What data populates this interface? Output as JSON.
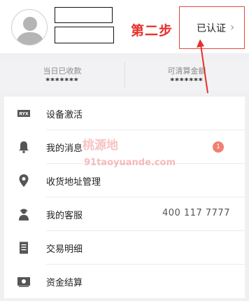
{
  "header": {
    "annotation_step": "第二步",
    "verify_label": "已认证",
    "verify_chevron": "›"
  },
  "stats": [
    {
      "caption": "当日已收款",
      "value": "*******"
    },
    {
      "caption": "可清算金额",
      "value": "*******"
    }
  ],
  "menu": [
    {
      "label": "设备激活",
      "icon": "device-activation-icon"
    },
    {
      "label": "我的消息",
      "icon": "bell-icon",
      "badge": "1"
    },
    {
      "label": "收货地址管理",
      "icon": "location-pin-icon"
    },
    {
      "label": "我的客服",
      "icon": "customer-service-icon",
      "value": "400 117 7777"
    },
    {
      "label": "交易明细",
      "icon": "document-icon"
    },
    {
      "label": "资金结算",
      "icon": "cash-icon"
    }
  ],
  "watermark": {
    "line1": "桃源地",
    "line2": "91taoyuande.com"
  },
  "colors": {
    "annotation_red": "#e8302a",
    "badge": "#f08070",
    "icon_gray": "#555555"
  }
}
